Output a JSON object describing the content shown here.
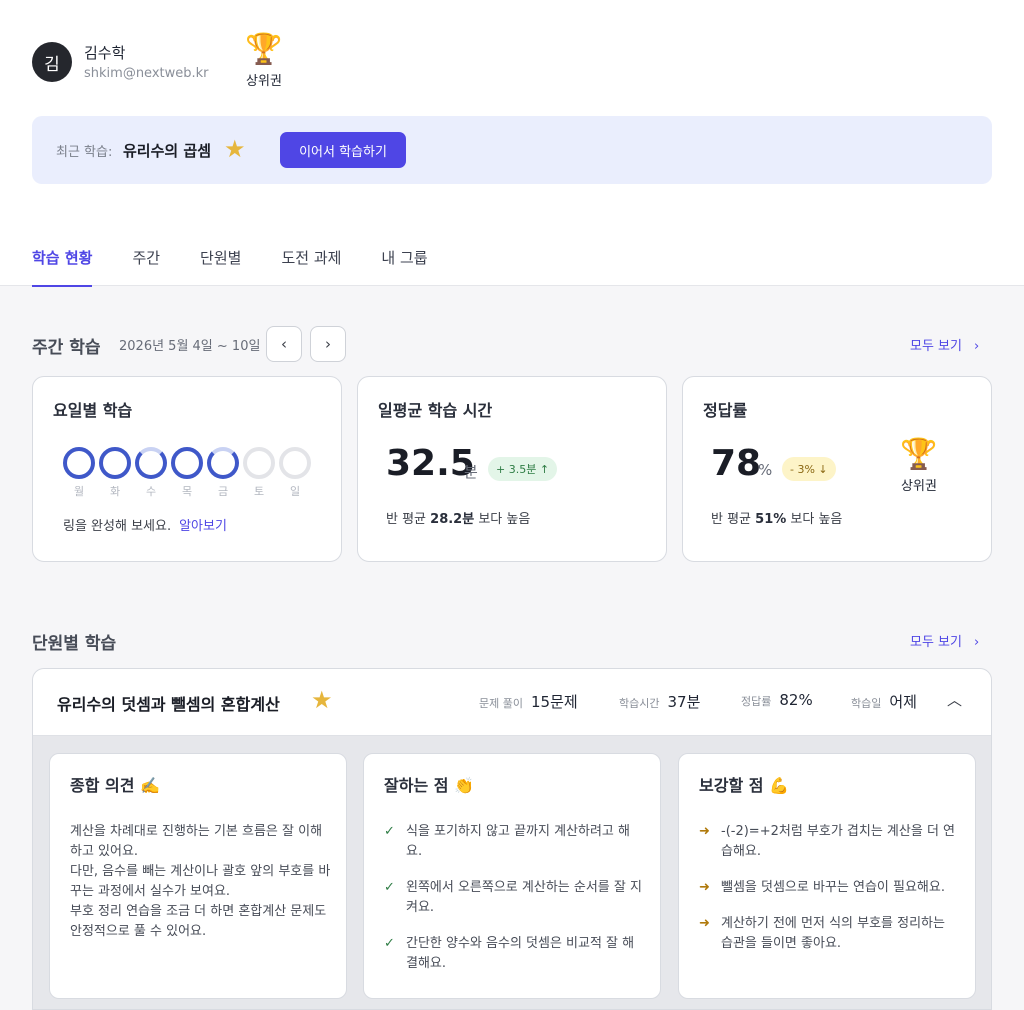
{
  "user": {
    "avatar_initial": "김",
    "name": "김수학",
    "email": "shkim@nextweb.kr"
  },
  "top_rank": {
    "icon": "trophy-icon",
    "label": "상위권"
  },
  "recent": {
    "label": "최근 학습:",
    "title": "유리수의 곱셈",
    "star_icon": "star-icon",
    "button": "이어서 학습하기"
  },
  "tabs": [
    {
      "label": "학습 현황",
      "active": true
    },
    {
      "label": "주간"
    },
    {
      "label": "단원별"
    },
    {
      "label": "도전 과제"
    },
    {
      "label": "내 그룹"
    }
  ],
  "weekly": {
    "title": "주간 학습",
    "date_range": "2026년 5월 4일 ~ 10일",
    "prev_icon": "chevron-left-icon",
    "next_icon": "chevron-right-icon",
    "see_all": "모두 보기",
    "cards": {
      "daily": {
        "title": "요일별 학습",
        "days": [
          {
            "label": "월",
            "status": "complete"
          },
          {
            "label": "화",
            "status": "complete"
          },
          {
            "label": "수",
            "status": "partial"
          },
          {
            "label": "목",
            "status": "complete"
          },
          {
            "label": "금",
            "status": "partial"
          },
          {
            "label": "토",
            "status": "empty"
          },
          {
            "label": "일",
            "status": "empty"
          }
        ],
        "hint": "링을 완성해 보세요.",
        "hint_link": "알아보기"
      },
      "time": {
        "title": "일평균 학습 시간",
        "value": "32.5",
        "unit": "분",
        "change": "+ 3.5분 ↑",
        "compare_prefix": "반 평균 ",
        "compare_value": "28.2분",
        "compare_suffix": " 보다 높음"
      },
      "accuracy": {
        "title": "정답률",
        "value": "78",
        "unit": "%",
        "change": "- 3% ↓",
        "rank_label": "상위권",
        "compare_prefix": "반 평균 ",
        "compare_value": "51%",
        "compare_suffix": " 보다 높음"
      }
    }
  },
  "unit_section": {
    "title": "단원별 학습",
    "see_all": "모두 보기",
    "unit": {
      "title": "유리수의 덧셈과 뺄셈의 혼합계산",
      "stats": [
        {
          "label": "문제 풀이",
          "value": "15문제"
        },
        {
          "label": "학습시간",
          "value": "37분"
        },
        {
          "label": "정답률",
          "value": "82%"
        },
        {
          "label": "학습일",
          "value": "어제"
        }
      ],
      "overall": {
        "title": "종합 의견 ✍️",
        "body": "계산을 차례대로 진행하는 기본 흐름은 잘 이해하고 있어요.\n다만, 음수를 빼는 계산이나 괄호 앞의 부호를 바꾸는 과정에서 실수가 보여요.\n부호 정리 연습을 조금 더 하면 혼합계산 문제도 안정적으로 풀 수 있어요."
      },
      "strengths": {
        "title": "잘하는 점 👏",
        "items": [
          "식을 포기하지 않고 끝까지 계산하려고 해요.",
          "왼쪽에서 오른쪽으로 계산하는 순서를 잘 지켜요.",
          "간단한 양수와 음수의 덧셈은 비교적 잘 해결해요."
        ]
      },
      "improvements": {
        "title": "보강할 점 💪",
        "items": [
          "-(-2)=+2처럼 부호가 겹치는 계산을 더 연습해요.",
          "뺄셈을 덧셈으로 바꾸는 연습이 필요해요.",
          "계산하기 전에 먼저 식의 부호를 정리하는 습관을 들이면 좋아요."
        ]
      }
    }
  },
  "colors": {
    "accent": "#4f46e5",
    "ring": "#3f58c9",
    "banner": "#eaeefd"
  }
}
